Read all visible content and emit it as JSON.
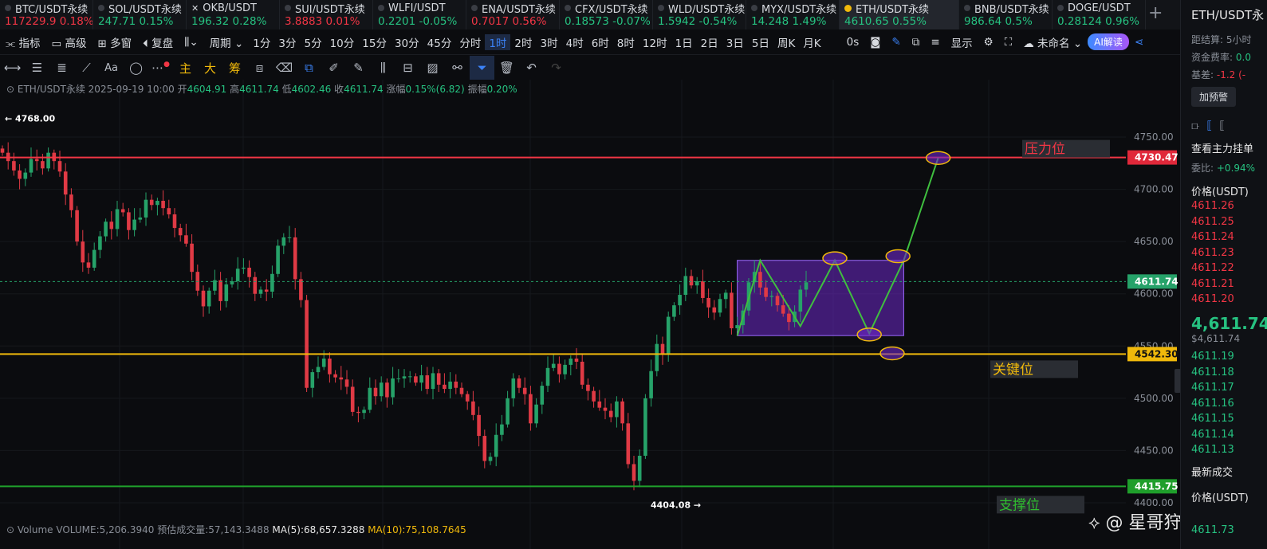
{
  "tabs": [
    {
      "name": "BTC/USDT永续",
      "price": "117229.9",
      "change": "0.18%",
      "dir": "down",
      "icon": "none"
    },
    {
      "name": "SOL/USDT永续",
      "price": "247.71",
      "change": "0.15%",
      "dir": "up",
      "icon": "none"
    },
    {
      "name": "OKB/USDT",
      "price": "196.32",
      "change": "0.28%",
      "dir": "up",
      "icon": "close-x"
    },
    {
      "name": "SUI/USDT永续",
      "price": "3.8883",
      "change": "0.01%",
      "dir": "down",
      "icon": "none"
    },
    {
      "name": "WLFI/USDT",
      "price": "0.2201",
      "change": "-0.05%",
      "dir": "up",
      "icon": "none"
    },
    {
      "name": "ENA/USDT永续",
      "price": "0.7017",
      "change": "0.56%",
      "dir": "down",
      "icon": "none"
    },
    {
      "name": "CFX/USDT永续",
      "price": "0.18573",
      "change": "-0.07%",
      "dir": "up",
      "icon": "none"
    },
    {
      "name": "WLD/USDT永续",
      "price": "1.5942",
      "change": "-0.54%",
      "dir": "up",
      "icon": "none"
    },
    {
      "name": "MYX/USDT永续",
      "price": "14.248",
      "change": "1.49%",
      "dir": "up",
      "icon": "none"
    },
    {
      "name": "ETH/USDT永续",
      "price": "4610.65",
      "change": "0.55%",
      "dir": "up",
      "icon": "coin",
      "active": true
    },
    {
      "name": "BNB/USDT永续",
      "price": "986.64",
      "change": "0.5%",
      "dir": "up",
      "icon": "none"
    },
    {
      "name": "DOGE/USDT",
      "price": "0.28124",
      "change": "0.96%",
      "dir": "up",
      "icon": "none"
    }
  ],
  "toolbar": {
    "indicator": "指标",
    "advanced": "高级",
    "multi_window": "多窗",
    "replay": "复盘",
    "period": "周期",
    "intervals": [
      "1分",
      "3分",
      "5分",
      "10分",
      "15分",
      "30分",
      "45分",
      "分时",
      "1时",
      "2时",
      "3时",
      "4时",
      "6时",
      "8时",
      "12时",
      "1日",
      "2日",
      "3日",
      "5日",
      "周K",
      "月K"
    ],
    "active_interval": "1时",
    "countdown": "0s",
    "display": "显示",
    "unnamed": "未命名",
    "ai_label": "AI解读"
  },
  "drawbar": {
    "main": "主",
    "big": "大",
    "chip": "筹"
  },
  "info": {
    "symbol": "ETH/USDT永续",
    "datetime": "2025-09-19 10:00",
    "open_label": "开",
    "open": "4604.91",
    "high_label": "高",
    "high": "4611.74",
    "low_label": "低",
    "low": "4602.46",
    "close_label": "收",
    "close": "4611.74",
    "change_label": "涨幅",
    "change": "0.15%(6.82)",
    "amp_label": "振幅",
    "amp": "0.20%"
  },
  "volume": {
    "label": "Volume",
    "value": "VOLUME:5,206.3940",
    "est": "预估成交量:57,143.3488",
    "ma5": "MA(5):68,657.3288",
    "ma10": "MA(10):75,108.7645"
  },
  "chart_data": {
    "type": "candlestick",
    "ylim": [
      4385,
      4790
    ],
    "y_ticks": [
      4750,
      4700,
      4650,
      4600,
      4550,
      4500,
      4450,
      4400
    ],
    "levels": [
      {
        "value": 4730.47,
        "label": "4730.47",
        "color": "#f23645",
        "annotation": "压力位"
      },
      {
        "value": 4542.3,
        "label": "4542.30",
        "color": "#f0b90b",
        "annotation": "关键位"
      },
      {
        "value": 4415.75,
        "label": "4415.75",
        "color": "#1fa12b",
        "annotation": "支撑位"
      }
    ],
    "last_price": {
      "value": 4611.74,
      "label": "4611.74"
    },
    "high_marker": {
      "value": 4768.0,
      "label": "4768.00"
    },
    "low_marker": {
      "value": 4404.08,
      "label": "4404.08"
    },
    "box": {
      "from_index": 128,
      "to_index": 157,
      "top": 4632,
      "bottom": 4560
    },
    "projection_path": [
      {
        "i": 128,
        "v": 4560
      },
      {
        "i": 132,
        "v": 4632
      },
      {
        "i": 139,
        "v": 4569
      },
      {
        "i": 145,
        "v": 4632
      },
      {
        "i": 151,
        "v": 4562
      },
      {
        "i": 157,
        "v": 4632
      },
      {
        "i": 163,
        "v": 4730
      }
    ],
    "ellipses": [
      {
        "i": 145,
        "v": 4634
      },
      {
        "i": 151,
        "v": 4561
      },
      {
        "i": 156,
        "v": 4636
      },
      {
        "i": 155,
        "v": 4543
      },
      {
        "i": 163,
        "v": 4730
      }
    ],
    "closes": [
      4735,
      4727,
      4718,
      4710,
      4716,
      4729,
      4727,
      4720,
      4735,
      4727,
      4717,
      4695,
      4680,
      4650,
      4630,
      4625,
      4642,
      4655,
      4669,
      4662,
      4681,
      4678,
      4661,
      4671,
      4673,
      4690,
      4685,
      4689,
      4682,
      4676,
      4663,
      4656,
      4648,
      4621,
      4603,
      4588,
      4603,
      4613,
      4593,
      4609,
      4612,
      4624,
      4625,
      4616,
      4600,
      4604,
      4602,
      4619,
      4646,
      4654,
      4654,
      4614,
      4594,
      4510,
      4525,
      4530,
      4538,
      4523,
      4520,
      4518,
      4511,
      4487,
      4486,
      4489,
      4510,
      4502,
      4515,
      4501,
      4519,
      4519,
      4521,
      4521,
      4515,
      4522,
      4509,
      4524,
      4513,
      4509,
      4516,
      4510,
      4504,
      4497,
      4484,
      4464,
      4440,
      4444,
      4465,
      4475,
      4500,
      4519,
      4510,
      4504,
      4476,
      4494,
      4512,
      4529,
      4533,
      4523,
      4532,
      4538,
      4535,
      4513,
      4507,
      4497,
      4491,
      4488,
      4482,
      4497,
      4476,
      4437,
      4421,
      4445,
      4500,
      4526,
      4552,
      4542,
      4578,
      4589,
      4599,
      4617,
      4608,
      4612,
      4596,
      4587,
      4582,
      4595,
      4601,
      4567,
      4570,
      4584,
      4611,
      4621,
      4606,
      4597,
      4598,
      4589,
      4581,
      4573,
      4583,
      4604,
      4611
    ]
  },
  "side": {
    "symbol": "ETH/USDT永",
    "settle_label": "距结算",
    "settle": "5小时",
    "funding_label": "资金费率:",
    "funding": "0.0",
    "basis_label": "基差:",
    "basis": "-1.2 (-",
    "alert": "加预警",
    "view_main": "查看主力挂单",
    "ratio_label": "委比:",
    "ratio": "+0.94%",
    "price_header": "价格(USDT)",
    "asks": [
      "4611.26",
      "4611.25",
      "4611.24",
      "4611.23",
      "4611.22",
      "4611.21",
      "4611.20"
    ],
    "mid": "4,611.74",
    "mid_sub": "$4,611.74",
    "bids": [
      "4611.19",
      "4611.18",
      "4611.17",
      "4611.16",
      "4611.15",
      "4611.14",
      "4611.13"
    ],
    "latest": "最新成交",
    "price_header2": "价格(USDT)",
    "trade_row": "4611.73"
  },
  "watermark": "星哥狩猎日记"
}
